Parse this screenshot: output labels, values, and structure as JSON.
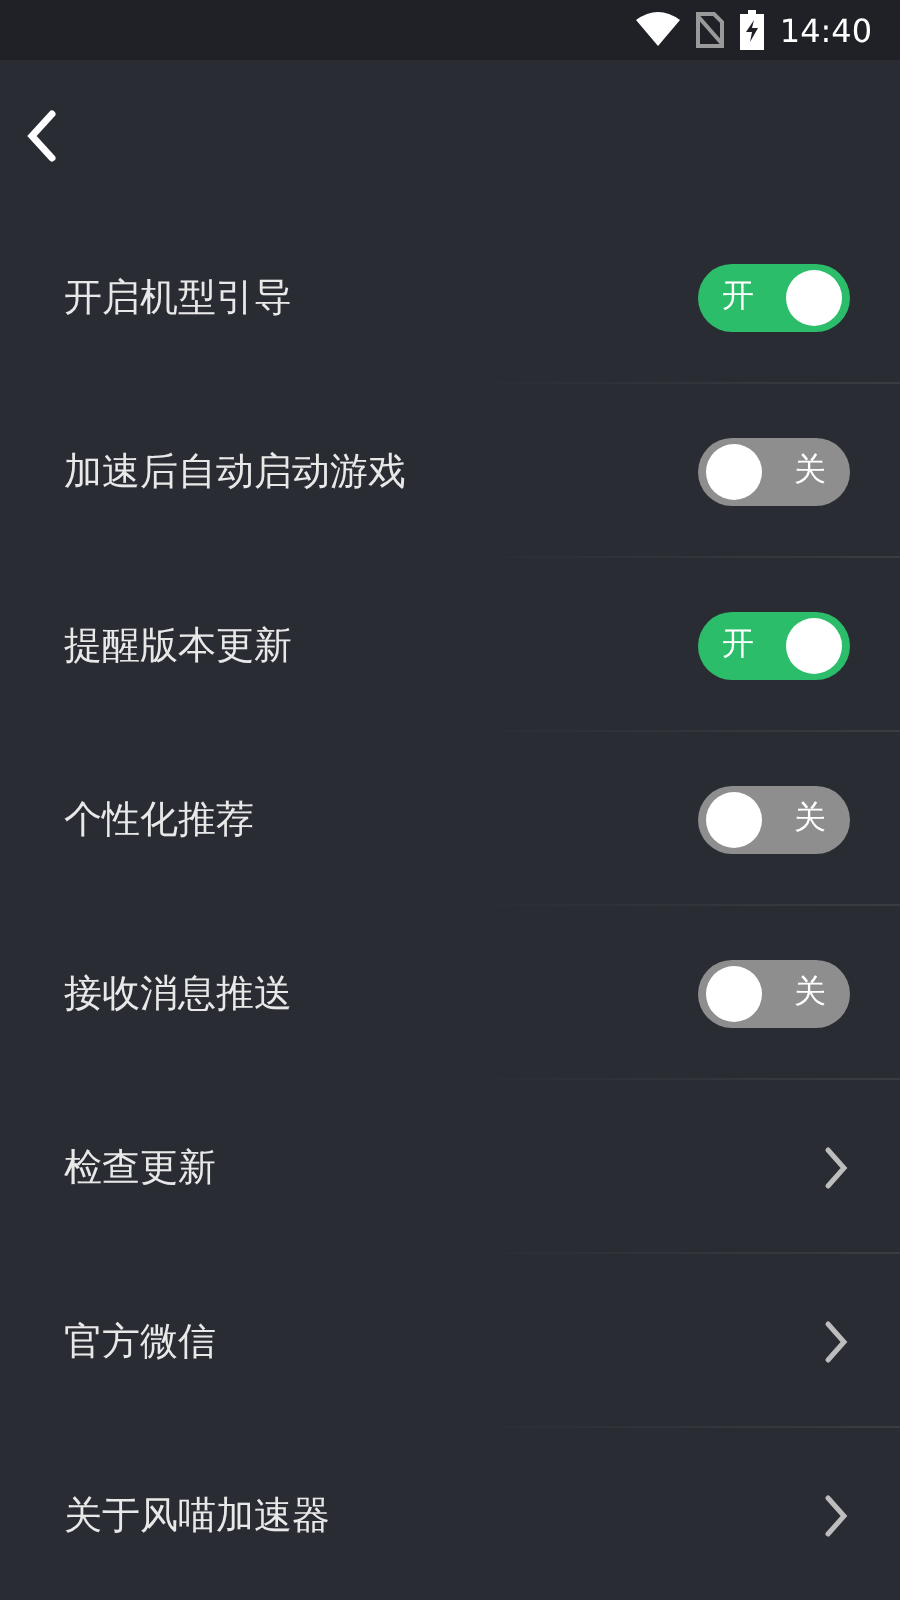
{
  "status_bar": {
    "time": "14:40"
  },
  "settings": [
    {
      "kind": "toggle",
      "label": "开启机型引导",
      "on": true,
      "switch_text": "开"
    },
    {
      "kind": "toggle",
      "label": "加速后自动启动游戏",
      "on": false,
      "switch_text": "关"
    },
    {
      "kind": "toggle",
      "label": "提醒版本更新",
      "on": true,
      "switch_text": "开"
    },
    {
      "kind": "toggle",
      "label": "个性化推荐",
      "on": false,
      "switch_text": "关"
    },
    {
      "kind": "toggle",
      "label": "接收消息推送",
      "on": false,
      "switch_text": "关"
    },
    {
      "kind": "link",
      "label": "检查更新"
    },
    {
      "kind": "link",
      "label": "官方微信"
    },
    {
      "kind": "link",
      "label": "关于风喵加速器"
    }
  ]
}
